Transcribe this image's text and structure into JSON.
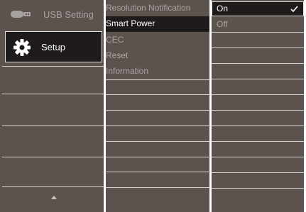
{
  "menu": {
    "items": [
      {
        "label": "USB Setting",
        "icon": "usb-icon"
      },
      {
        "label": "Setup",
        "icon": "gear-icon"
      }
    ],
    "scroll_icon": "up-arrow-icon"
  },
  "submenu": {
    "items": [
      {
        "label": "Resolution Notification"
      },
      {
        "label": "Smart Power"
      },
      {
        "label": "CEC"
      },
      {
        "label": "Reset"
      },
      {
        "label": "Information"
      }
    ],
    "selected_index": 1
  },
  "options": {
    "items": [
      {
        "label": "On"
      },
      {
        "label": "Off"
      }
    ],
    "checked_icon": "check-icon"
  },
  "colors": {
    "panel_bg": "#5c534f",
    "selected_bg": "#1e1b1a",
    "inactive_text": "#aaa4a0",
    "active_text": "#ffffff"
  }
}
